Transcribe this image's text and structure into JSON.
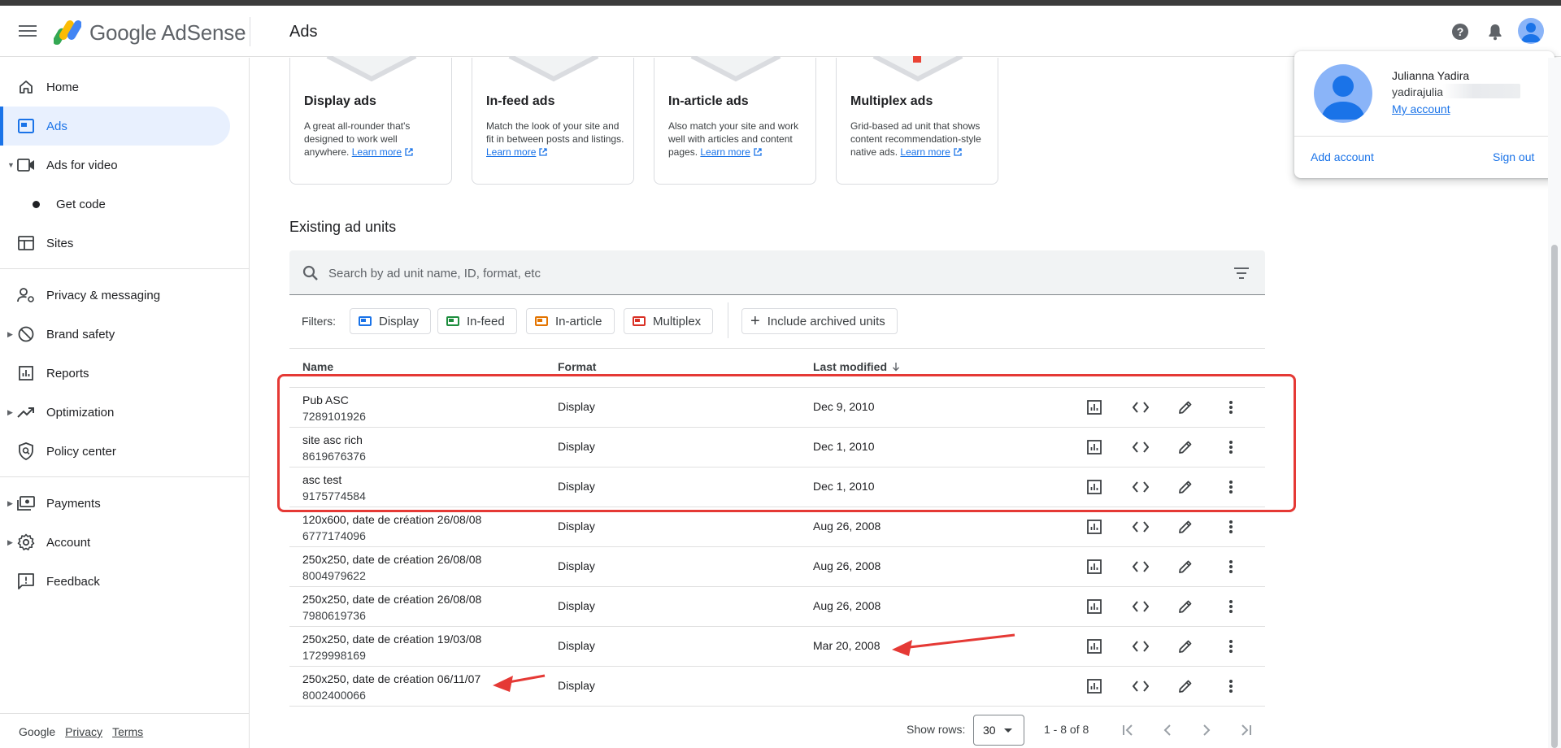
{
  "header": {
    "brand": "Google AdSense",
    "page_title": "Ads"
  },
  "sidebar": {
    "items": [
      {
        "label": "Home",
        "icon": "home-icon"
      },
      {
        "label": "Ads",
        "icon": "ads-icon",
        "active": true
      },
      {
        "label": "Ads for video",
        "icon": "video-icon"
      },
      {
        "label": "Get code",
        "icon": "dot-icon"
      },
      {
        "label": "Sites",
        "icon": "sites-icon"
      },
      {
        "label": "Privacy & messaging",
        "icon": "privacy-icon"
      },
      {
        "label": "Brand safety",
        "icon": "block-icon"
      },
      {
        "label": "Reports",
        "icon": "reports-icon"
      },
      {
        "label": "Optimization",
        "icon": "trending-icon"
      },
      {
        "label": "Policy center",
        "icon": "policy-icon"
      },
      {
        "label": "Payments",
        "icon": "payments-icon"
      },
      {
        "label": "Account",
        "icon": "gear-icon"
      },
      {
        "label": "Feedback",
        "icon": "feedback-icon"
      }
    ],
    "footer": {
      "google": "Google",
      "privacy": "Privacy",
      "terms": "Terms"
    }
  },
  "ad_types": [
    {
      "title": "Display ads",
      "desc": "A great all-rounder that's designed to work well anywhere.",
      "link": "Learn more"
    },
    {
      "title": "In-feed ads",
      "desc": "Match the look of your site and fit in between posts and listings.",
      "link": "Learn more"
    },
    {
      "title": "In-article ads",
      "desc": "Also match your site and work well with articles and content pages.",
      "link": "Learn more"
    },
    {
      "title": "Multiplex ads",
      "desc": "Grid-based ad unit that shows content recommendation-style native ads.",
      "link": "Learn more"
    }
  ],
  "existing": {
    "title": "Existing ad units",
    "search_placeholder": "Search by ad unit name, ID, format, etc",
    "filters_label": "Filters:",
    "filters": [
      {
        "label": "Display",
        "color": "#1a73e8"
      },
      {
        "label": "In-feed",
        "color": "#1e8e3e"
      },
      {
        "label": "In-article",
        "color": "#e37400"
      },
      {
        "label": "Multiplex",
        "color": "#d93025"
      }
    ],
    "archived_label": "Include archived units",
    "columns": {
      "name": "Name",
      "format": "Format",
      "modified": "Last modified"
    },
    "rows": [
      {
        "name": "Pub ASC",
        "id": "7289101926",
        "format": "Display",
        "modified": "Dec 9, 2010"
      },
      {
        "name": "site asc rich",
        "id": "8619676376",
        "format": "Display",
        "modified": "Dec 1, 2010"
      },
      {
        "name": "asc test",
        "id": "9175774584",
        "format": "Display",
        "modified": "Dec 1, 2010"
      },
      {
        "name": "120x600, date de création 26/08/08",
        "id": "6777174096",
        "format": "Display",
        "modified": "Aug 26, 2008"
      },
      {
        "name": "250x250, date de création 26/08/08",
        "id": "8004979622",
        "format": "Display",
        "modified": "Aug 26, 2008"
      },
      {
        "name": "250x250, date de création 26/08/08",
        "id": "7980619736",
        "format": "Display",
        "modified": "Aug 26, 2008"
      },
      {
        "name": "250x250, date de création 19/03/08",
        "id": "1729998169",
        "format": "Display",
        "modified": "Mar 20, 2008"
      },
      {
        "name": "250x250, date de création 06/11/07",
        "id": "8002400066",
        "format": "Display",
        "modified": ""
      }
    ],
    "pager": {
      "show_rows_label": "Show rows:",
      "rows_value": "30",
      "range": "1 - 8 of 8"
    }
  },
  "account_popup": {
    "name": "Julianna Yadira",
    "email_visible": "yadirajulia",
    "my_account": "My account",
    "add_account": "Add account",
    "sign_out": "Sign out"
  },
  "colors": {
    "accent": "#1a73e8",
    "annotation": "#e53935",
    "active_bg": "#e8f0fe"
  }
}
